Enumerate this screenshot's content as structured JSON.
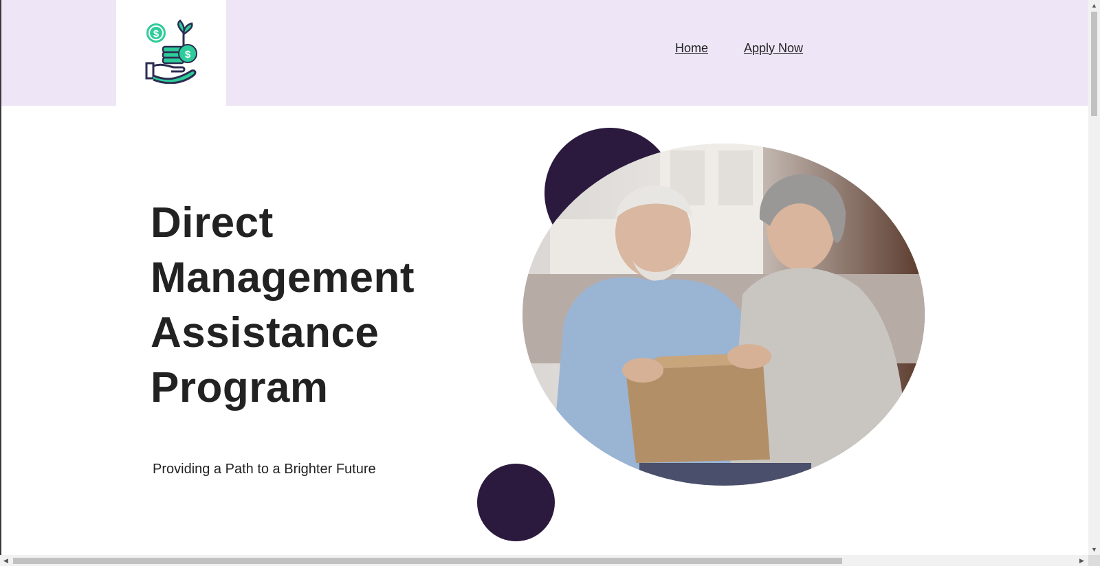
{
  "header": {
    "logo_name": "hand-coins-plant-logo",
    "nav": [
      {
        "label": "Home"
      },
      {
        "label": "Apply Now"
      }
    ]
  },
  "hero": {
    "title_lines": [
      "Direct",
      "Management",
      "Assistance",
      "Program"
    ],
    "subtitle": "Providing a Path to a Brighter Future",
    "image_description": "senior-couple-opening-box-photo"
  },
  "colors": {
    "header_bg": "#eee5f6",
    "accent_dark": "#2b1a3e",
    "logo_green": "#2ecc9a",
    "logo_navy": "#2b2d52"
  }
}
